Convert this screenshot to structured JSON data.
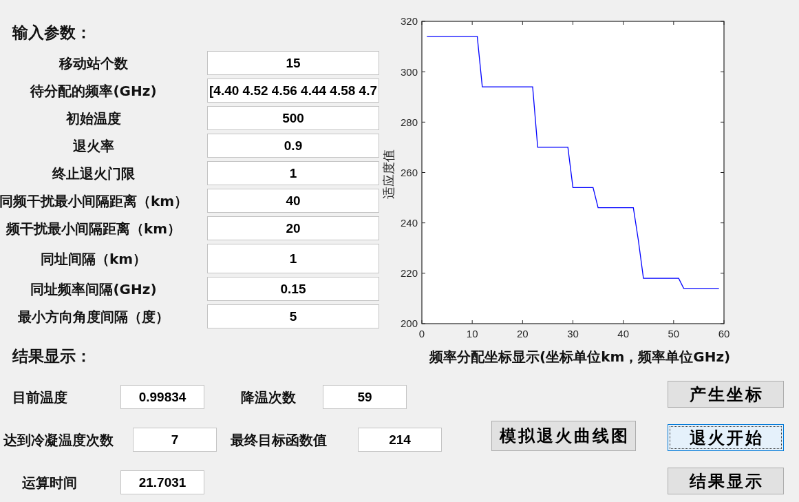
{
  "input_section": {
    "heading": "输入参数：",
    "parameters": [
      {
        "label": "移动站个数",
        "value": "15"
      },
      {
        "label": "待分配的频率(GHz)",
        "value": "[4.40 4.52 4.56 4.44 4.58 4.7"
      },
      {
        "label": "初始温度",
        "value": "500"
      },
      {
        "label": "退火率",
        "value": "0.9"
      },
      {
        "label": "终止退火门限",
        "value": "1"
      },
      {
        "label": "同频干扰最小间隔距离（km）",
        "value": "40"
      },
      {
        "label": "频干扰最小间隔距离（km）",
        "value": "20"
      },
      {
        "label": "同址间隔（km）",
        "value": "1"
      },
      {
        "label": "同址频率间隔(GHz)",
        "value": "0.15"
      },
      {
        "label": "最小方向角度间隔（度）",
        "value": "5"
      }
    ]
  },
  "chart": {
    "chart_data": {
      "type": "line",
      "ylabel": "适应度值",
      "x": [
        1,
        2,
        3,
        4,
        5,
        6,
        7,
        8,
        9,
        10,
        11,
        12,
        13,
        14,
        15,
        16,
        17,
        18,
        19,
        20,
        21,
        22,
        23,
        24,
        25,
        26,
        27,
        28,
        29,
        30,
        31,
        32,
        33,
        34,
        35,
        36,
        37,
        38,
        39,
        40,
        41,
        42,
        43,
        44,
        45,
        46,
        47,
        48,
        49,
        50,
        51,
        52,
        53,
        54,
        55,
        56,
        57,
        58,
        59
      ],
      "series": [
        {
          "color": "#0000ff",
          "values": [
            314,
            314,
            314,
            314,
            314,
            314,
            314,
            314,
            314,
            314,
            314,
            294,
            294,
            294,
            294,
            294,
            294,
            294,
            294,
            294,
            294,
            294,
            270,
            270,
            270,
            270,
            270,
            270,
            270,
            254,
            254,
            254,
            254,
            254,
            246,
            246,
            246,
            246,
            246,
            246,
            246,
            246,
            233,
            218,
            218,
            218,
            218,
            218,
            218,
            218,
            218,
            214,
            214,
            214,
            214,
            214,
            214,
            214,
            214
          ]
        }
      ],
      "xlim": [
        0,
        60
      ],
      "ylim": [
        200,
        320
      ],
      "xticks": [
        0,
        10,
        20,
        30,
        40,
        50,
        60
      ],
      "yticks": [
        200,
        220,
        240,
        260,
        280,
        300,
        320
      ]
    }
  },
  "result_section": {
    "heading": "结果显示：",
    "items": [
      {
        "label": "目前温度",
        "value": "0.99834"
      },
      {
        "label": "降温次数",
        "value": "59"
      },
      {
        "label": "达到冷凝温度次数",
        "value": "7"
      },
      {
        "label": "最终目标函数值",
        "value": "214"
      },
      {
        "label": "运算时间",
        "value": "21.7031"
      }
    ]
  },
  "coordinate_caption": "频率分配坐标显示(坐标单位km，频率单位GHz)",
  "plot_button": {
    "label": "模拟退火曲线图",
    "focused": false
  },
  "action_buttons": [
    {
      "label": "产生坐标",
      "focused": false
    },
    {
      "label": "退火开始",
      "focused": true
    },
    {
      "label": "结果显示",
      "focused": false
    }
  ]
}
